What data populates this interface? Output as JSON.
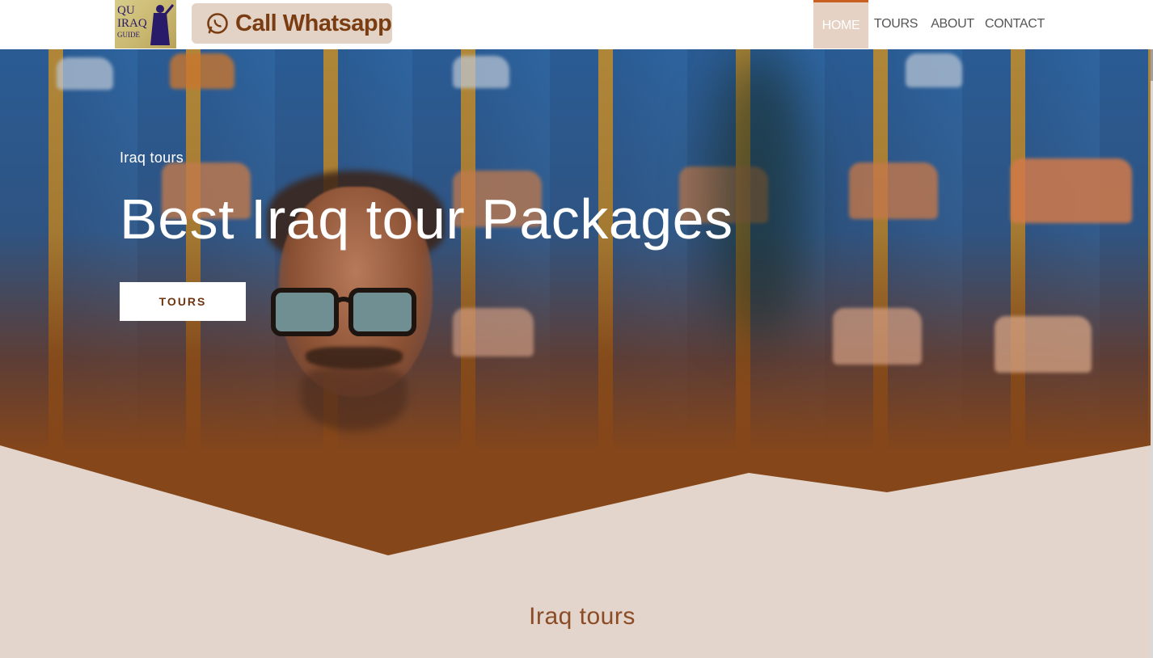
{
  "header": {
    "logo": {
      "line1": "QU",
      "line2": "IRAQ",
      "line3": "GUIDE"
    },
    "whatsapp_button": {
      "label": "Call Whatsapp",
      "icon": "whatsapp-icon"
    },
    "nav": {
      "home": "HOME",
      "tours": "TOURS",
      "about": "ABOUT",
      "contact": "CONTACT",
      "active": "HOME"
    }
  },
  "hero": {
    "subtitle": "Iraq tours",
    "title": "Best Iraq tour Packages",
    "button_label": "TOURS"
  },
  "section": {
    "title": "Iraq tours"
  },
  "colors": {
    "accent": "#c8601f",
    "brand_brown": "#85461a",
    "page_background": "#e3d5cb",
    "whatsapp_button_bg": "#e3d2c6",
    "button_text": "#6e3510"
  }
}
